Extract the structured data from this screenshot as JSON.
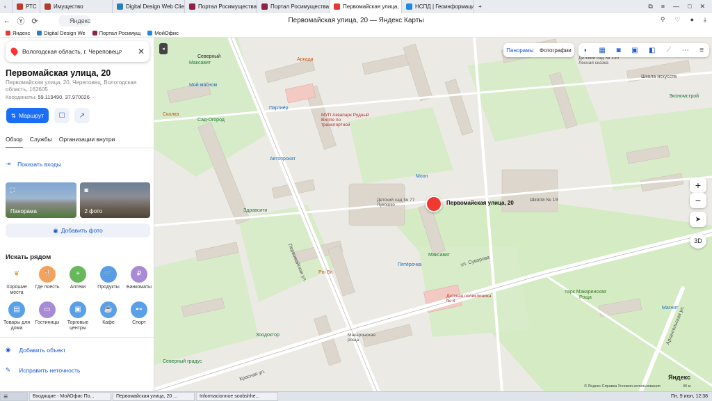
{
  "browser": {
    "tabs": [
      {
        "label": "РТС",
        "color": "#c0392b",
        "active": false
      },
      {
        "label": "Имущество",
        "color": "#b03a2e",
        "active": false
      },
      {
        "label": "Digital Design Web Client",
        "color": "#2980b9",
        "active": false
      },
      {
        "label": "Портал Росимущества",
        "color": "#8e2348",
        "active": false
      },
      {
        "label": "Портал Росимущества",
        "color": "#8e2348",
        "active": false
      },
      {
        "label": "Первомайская улица,",
        "color": "#e53935",
        "active": true
      },
      {
        "label": "НСПД | Геоинформацио",
        "color": "#1e88e5",
        "active": false
      }
    ],
    "address_placeholder": "Яндекс",
    "page_title": "Первомайская улица, 20 — Яндекс Карты",
    "bookmarks": [
      {
        "label": "Яндекс",
        "color": "#e53935"
      },
      {
        "label": "Digital Design We",
        "color": "#2980b9"
      },
      {
        "label": "Портал Росимущ",
        "color": "#8e2348"
      },
      {
        "label": "МойОфис",
        "color": "#1e88e5"
      }
    ]
  },
  "sidebar": {
    "search_value": "Вологодская область, г. Череповец,",
    "place_name": "Первомайская улица, 20",
    "place_address": "Первомайская улица, 20, Череповец, Вологодская область, 162605",
    "coords_label": "Координаты:",
    "coords_value": "59.119490, 37.970026",
    "route_label": "Маршрут",
    "tabs": [
      "Обзор",
      "Службы",
      "Организации внутри"
    ],
    "show_entrances": "Показать входы",
    "photos": [
      {
        "label": "Панорама",
        "icon": "panorama-icon"
      },
      {
        "label": "2 фото",
        "icon": "camera-icon"
      }
    ],
    "add_photo": "Добавить фото",
    "nearby_title": "Искать рядом",
    "categories": [
      {
        "label": "Хорошие места",
        "color": "#ffffff",
        "icon": "laurel-icon"
      },
      {
        "label": "Где поесть",
        "color": "#f5a15a",
        "icon": "fork-icon"
      },
      {
        "label": "Аптеки",
        "color": "#66b85a",
        "icon": "pharmacy-icon"
      },
      {
        "label": "Продукты",
        "color": "#5a9de6",
        "icon": "basket-icon"
      },
      {
        "label": "Банкоматы",
        "color": "#a88ad6",
        "icon": "ruble-icon"
      },
      {
        "label": "Товары для дома",
        "color": "#5aa0e6",
        "icon": "bag-icon"
      },
      {
        "label": "Гостиницы",
        "color": "#a88ad6",
        "icon": "bed-icon"
      },
      {
        "label": "Торговые центры",
        "color": "#5aa0e6",
        "icon": "shopping-icon"
      },
      {
        "label": "Кафе",
        "color": "#5aa0e6",
        "icon": "cup-icon"
      },
      {
        "label": "Спорт",
        "color": "#5aa0e6",
        "icon": "dumbbell-icon"
      }
    ],
    "add_object": "Добавить объект",
    "fix_error": "Исправить неточность"
  },
  "map": {
    "panoramas": "Панорамы",
    "photos": "Фотографии",
    "pin_label": "Первомайская улица, 20",
    "zoom_in": "+",
    "zoom_out": "−",
    "btn_3d": "3D",
    "brand": "Яндекс",
    "copyright": "© Яндекс  Справка  Условия использования",
    "scale": "40 м",
    "labels": [
      {
        "text": "Северный",
        "kind": "poi"
      },
      {
        "text": "Аркада",
        "kind": "poi"
      },
      {
        "text": "Максавит",
        "kind": "poi"
      },
      {
        "text": "Мой мясном",
        "kind": "poi"
      },
      {
        "text": "Партнёр",
        "kind": "poi"
      },
      {
        "text": "МУП Аквапарк Рудный Вилле по транспортной",
        "kind": "poi"
      },
      {
        "text": "Скалка",
        "kind": "poi"
      },
      {
        "text": "Сад-Огород",
        "kind": "poi"
      },
      {
        "text": "Автопрокат",
        "kind": "poi"
      },
      {
        "text": "Moon",
        "kind": "poi"
      },
      {
        "text": "Детский сад № 77 Лукошко",
        "kind": "poi"
      },
      {
        "text": "Здравсити",
        "kind": "poi"
      },
      {
        "text": "Пятёрочка",
        "kind": "poi"
      },
      {
        "text": "Максавит",
        "kind": "poi"
      },
      {
        "text": "Poi Bit",
        "kind": "poi"
      },
      {
        "text": "Детская поликлиника № 3",
        "kind": "poi"
      },
      {
        "text": "Макаринская роща",
        "kind": "poi"
      },
      {
        "text": "Зоодоктор",
        "kind": "poi"
      },
      {
        "text": "Северный градус",
        "kind": "poi"
      },
      {
        "text": "Школа № 19",
        "kind": "poi"
      },
      {
        "text": "Детский сад № 130 Лесная сказка",
        "kind": "poi"
      },
      {
        "text": "Школа искусств",
        "kind": "poi"
      },
      {
        "text": "Экономстрой",
        "kind": "poi"
      },
      {
        "text": "парк Макаринская Роща",
        "kind": "park"
      },
      {
        "text": "Магнит",
        "kind": "poi"
      },
      {
        "text": "ул. Суворова",
        "kind": "street"
      },
      {
        "text": "Первомайская ул.",
        "kind": "street"
      },
      {
        "text": "Красная ул.",
        "kind": "street"
      },
      {
        "text": "Архангельская ул.",
        "kind": "street"
      }
    ]
  },
  "taskbar": {
    "items": [
      "Входящие - МойОфис По...",
      "Первомайская улица, 20 ...",
      "Informacionnoe soobshhe..."
    ],
    "clock": "Пн, 9 июн, 12:38"
  }
}
